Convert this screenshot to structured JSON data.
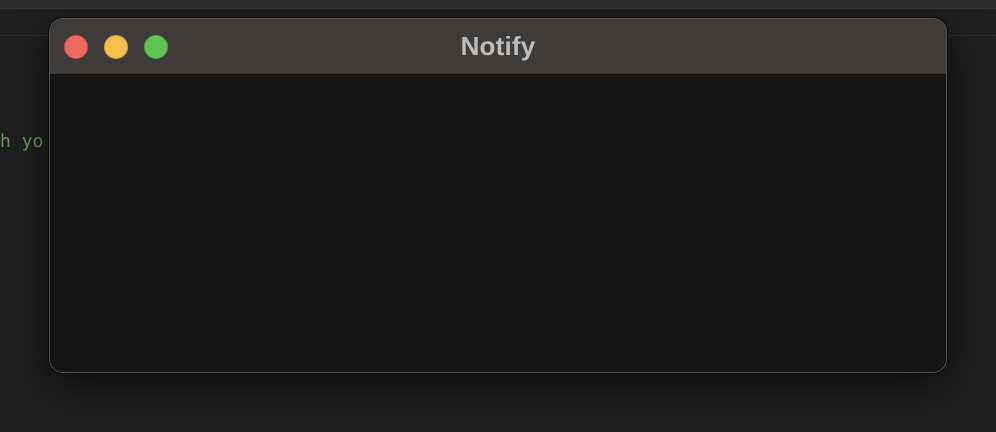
{
  "background_app": {
    "code_fragment": "h yo"
  },
  "window": {
    "title": "Notify",
    "controls": {
      "close_color": "#ed6a5e",
      "minimize_color": "#f4bf4f",
      "zoom_color": "#61c554"
    }
  }
}
